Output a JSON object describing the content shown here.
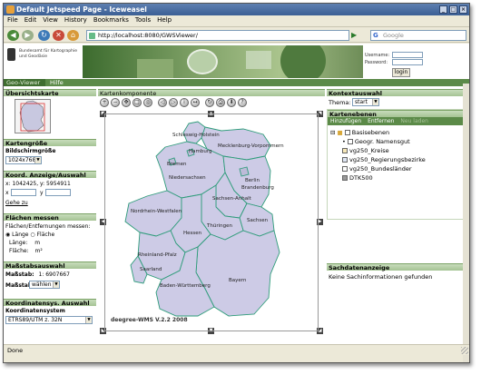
{
  "window": {
    "title": "Default Jetspeed Page - Iceweasel"
  },
  "menu": [
    "File",
    "Edit",
    "View",
    "History",
    "Bookmarks",
    "Tools",
    "Help"
  ],
  "navbar": {
    "url": "http://localhost:8080/GWSViewer/",
    "search_placeholder": "Google"
  },
  "banner": {
    "logo_text": "Bundesamt für Kartographie und Geodäsie",
    "username_label": "Username:",
    "password_label": "Password:",
    "login_button": "login"
  },
  "tabs": [
    "Geo-Viewer",
    "Hilfe"
  ],
  "left": {
    "overview_title": "Übersichtskarte",
    "mapsize_title": "Kartengröße",
    "mapsize_sublabel": "Bildschirmgröße",
    "mapsize_value": "1024x768",
    "coord_title": "Koord. Anzeige/Auswahl",
    "coord_readout": "x: 1042425, y: 5954911",
    "coord_x_label": "x",
    "coord_y_label": "y",
    "goto_label": "Gehe zu",
    "measure_title": "Flächen messen",
    "measure_question": "Flächen/Entfernungen messen:",
    "radio_length": "Länge",
    "radio_area": "Fläche",
    "length_label": "Länge:",
    "length_unit": "m",
    "area_label": "Fläche:",
    "area_unit": "m²",
    "scale_title": "Maßstabsauswahl",
    "scale_label": "Maßstab:",
    "scale_value": "1: 6907667",
    "scale_select_label": "Maßstab",
    "scale_select_value": "wählen",
    "crs_title": "Koordinatensys. Auswahl",
    "crs_label": "Koordinatensystem",
    "crs_value": "ETRS89/UTM z. 32N"
  },
  "map": {
    "title": "Kartenkomponente",
    "copyright": "deegree-WMS V.2.2 2008",
    "states": [
      {
        "name": "Schleswig-Holstein"
      },
      {
        "name": "Mecklenburg-Vorpommern"
      },
      {
        "name": "Hamburg"
      },
      {
        "name": "Bremen"
      },
      {
        "name": "Niedersachsen"
      },
      {
        "name": "Berlin"
      },
      {
        "name": "Brandenburg"
      },
      {
        "name": "Sachsen-Anhalt"
      },
      {
        "name": "Nordrhein-Westfalen"
      },
      {
        "name": "Thüringen"
      },
      {
        "name": "Sachsen"
      },
      {
        "name": "Hessen"
      },
      {
        "name": "Rheinland-Pfalz"
      },
      {
        "name": "Saarland"
      },
      {
        "name": "Baden-Württemberg"
      },
      {
        "name": "Bayern"
      }
    ]
  },
  "right": {
    "context_title": "Kontextauswahl",
    "theme_label": "Thema:",
    "theme_value": "start",
    "layers_title": "Kartenebenen",
    "btn_add": "Hinzufügen",
    "btn_remove": "Entfernen",
    "btn_reload": "Neu laden",
    "root_layer": "Basisebenen",
    "layers": [
      "Geogr. Namensgut",
      "vg250_Kreise",
      "vg250_Regierungsbezirke",
      "vg250_Bundesländer",
      "DTK500"
    ],
    "facts_title": "Sachdatenanzeige",
    "facts_text": "Keine Sachinformationen gefunden"
  },
  "status": "Done"
}
